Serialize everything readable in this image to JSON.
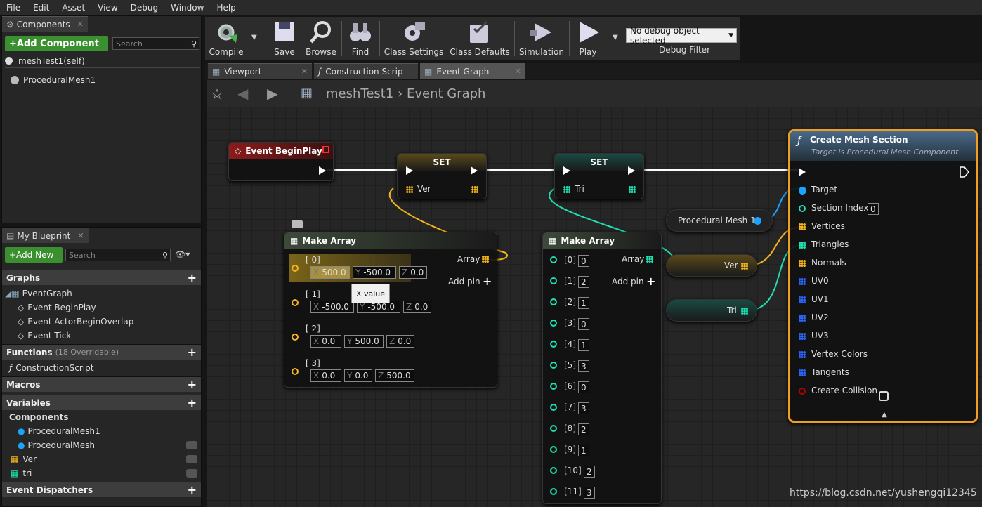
{
  "menu": [
    "File",
    "Edit",
    "Asset",
    "View",
    "Debug",
    "Window",
    "Help"
  ],
  "components_panel": {
    "tab": "Components",
    "add_button": "+Add Component",
    "search_placeholder": "Search",
    "root": "meshTest1(self)",
    "child": "ProceduralMesh1"
  },
  "blueprint_panel": {
    "tab": "My Blueprint",
    "add_new": "+Add New",
    "search_placeholder": "Search",
    "graphs_label": "Graphs",
    "event_graph": "EventGraph",
    "events": [
      "Event BeginPlay",
      "Event ActorBeginOverlap",
      "Event Tick"
    ],
    "functions_label": "Functions",
    "functions_note": "(18 Overridable)",
    "construction_script": "ConstructionScript",
    "macros_label": "Macros",
    "variables_label": "Variables",
    "components_label": "Components",
    "variables": [
      "ProceduralMesh1",
      "ProceduralMesh",
      "Ver",
      "tri"
    ],
    "dispatchers_label": "Event Dispatchers"
  },
  "toolbar": {
    "compile": "Compile",
    "save": "Save",
    "browse": "Browse",
    "find": "Find",
    "class_settings": "Class Settings",
    "class_defaults": "Class Defaults",
    "simulation": "Simulation",
    "play": "Play",
    "debug_select": "No debug object selected",
    "debug_filter": "Debug Filter"
  },
  "tabs": [
    "Viewport",
    "Construction Scrip",
    "Event Graph"
  ],
  "breadcrumb": {
    "root": "meshTest1",
    "current": "Event Graph"
  },
  "nodes": {
    "begin_play": "Event BeginPlay",
    "set1": {
      "title": "SET",
      "pin": "Ver"
    },
    "set2": {
      "title": "SET",
      "pin": "Tri"
    },
    "make_array1": {
      "title": "Make Array",
      "out": "Array",
      "add_pin": "Add pin",
      "rows": [
        {
          "label": "[ 0]",
          "x": "500.0",
          "y": "-500.0",
          "z": "0.0"
        },
        {
          "label": "[ 1]",
          "x": "-500.0",
          "y": "-500.0",
          "z": "0.0"
        },
        {
          "label": "[ 2]",
          "x": "0.0",
          "y": "500.0",
          "z": "0.0"
        },
        {
          "label": "[ 3]",
          "x": "0.0",
          "y": "0.0",
          "z": "500.0"
        }
      ],
      "tooltip": "X value"
    },
    "make_array2": {
      "title": "Make Array",
      "out": "Array",
      "add_pin": "Add pin",
      "rows": [
        {
          "label": "[0]",
          "v": "0"
        },
        {
          "label": "[1]",
          "v": "2"
        },
        {
          "label": "[2]",
          "v": "1"
        },
        {
          "label": "[3]",
          "v": "0"
        },
        {
          "label": "[4]",
          "v": "1"
        },
        {
          "label": "[5]",
          "v": "3"
        },
        {
          "label": "[6]",
          "v": "0"
        },
        {
          "label": "[7]",
          "v": "3"
        },
        {
          "label": "[8]",
          "v": "2"
        },
        {
          "label": "[9]",
          "v": "1"
        },
        {
          "label": "[10]",
          "v": "2"
        },
        {
          "label": "[11]",
          "v": "3"
        }
      ]
    },
    "proc_mesh": "Procedural Mesh 1",
    "get_ver": "Ver",
    "get_tri": "Tri",
    "create_mesh": {
      "title": "Create Mesh Section",
      "subtitle": "Target is Procedural Mesh Component",
      "pins": [
        "Target",
        "Section Index",
        "Vertices",
        "Triangles",
        "Normals",
        "UV0",
        "UV1",
        "UV2",
        "UV3",
        "Vertex Colors",
        "Tangents",
        "Create Collision"
      ],
      "section_index": "0"
    }
  },
  "watermark": "https://blog.csdn.net/yushengqi12345",
  "colors": {
    "vector": "#f5b51c",
    "int": "#1fe0b0",
    "object": "#1aa3ff",
    "bool": "#b00000",
    "exec": "#ffffff",
    "uv": "#2866ff"
  }
}
